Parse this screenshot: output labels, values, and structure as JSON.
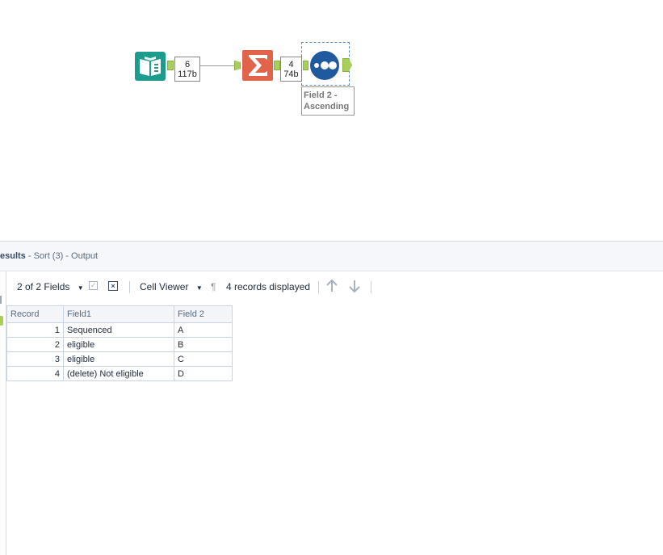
{
  "canvas": {
    "conn1": {
      "count": "6",
      "size": "117b"
    },
    "conn2": {
      "count": "4",
      "size": "74b"
    },
    "sort_annotation": [
      "Field 2 -",
      "Ascending"
    ],
    "colors": {
      "input_tool": "#1b9c8c",
      "summarize_tool": "#e0634a",
      "sort_tool": "#1f5a9e",
      "anchor": "#a7cf5a"
    },
    "icons": [
      "book-input-icon",
      "sigma-summarize-icon",
      "sort-dots-icon"
    ]
  },
  "results": {
    "title_prefix": "esults",
    "title_suffix": " - Sort (3) - Output",
    "toolbar": {
      "fields": "2 of 2 Fields",
      "cell_viewer": "Cell Viewer",
      "pilcrow": "¶",
      "records": "4 records displayed"
    },
    "columns": [
      "Record",
      "Field1",
      "Field 2"
    ],
    "rows": [
      {
        "record": "1",
        "field1": "Sequenced",
        "field2": "A"
      },
      {
        "record": "2",
        "field1": "eligible",
        "field2": "B"
      },
      {
        "record": "3",
        "field1": "eligible",
        "field2": "C"
      },
      {
        "record": "4",
        "field1": "(delete) Not eligible",
        "field2": "D"
      }
    ]
  }
}
